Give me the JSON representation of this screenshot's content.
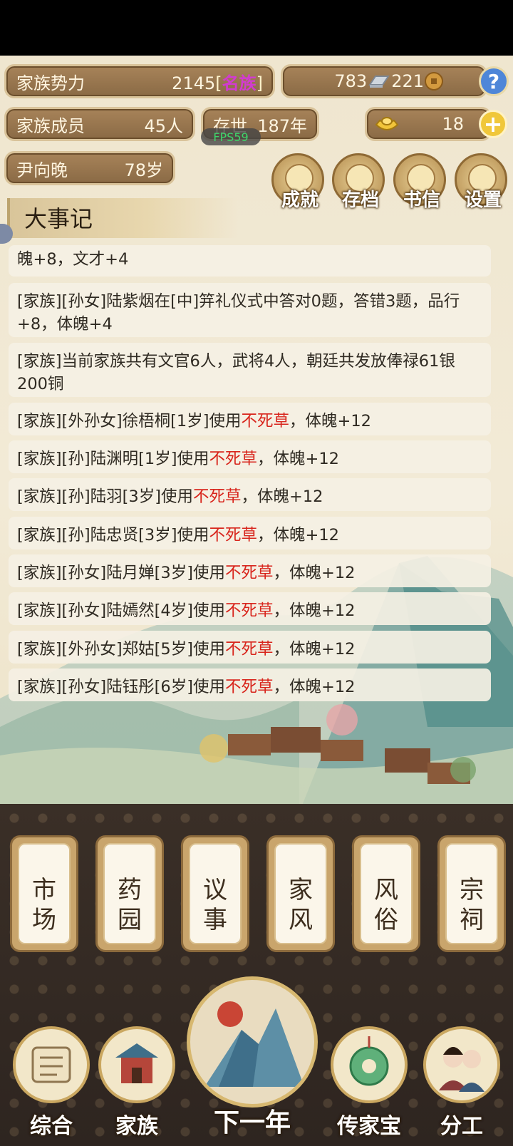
{
  "header": {
    "clan_power_label": "家族势力",
    "clan_power_value": "2145",
    "bracket_open": "[",
    "clan_rank": "名族",
    "bracket_close": "]",
    "silver": "783",
    "copper": "221",
    "help_icon_text": "?",
    "members_label": "家族成员",
    "members_value": "45人",
    "existence_label": "存世",
    "existence_value": "187年",
    "gold": "18",
    "plus_text": "+",
    "leader_name": "尹向晚",
    "leader_age": "78岁",
    "fps": "FPS59"
  },
  "menu_buttons": [
    {
      "label": "成就",
      "icon": "achievement-icon"
    },
    {
      "label": "存档",
      "icon": "save-icon"
    },
    {
      "label": "书信",
      "icon": "letter-icon"
    },
    {
      "label": "设置",
      "icon": "settings-icon"
    }
  ],
  "chronicle": {
    "title": "大事记",
    "entries": [
      {
        "pre": "魄+8，文才+4",
        "red": "",
        "post": ""
      },
      {
        "pre": "[家族][孙女]陆紫烟在[中]笄礼仪式中答对0题，答错3题，品行+8，体魄+4",
        "red": "",
        "post": ""
      },
      {
        "pre": "[家族]当前家族共有文官6人，武将4人，朝廷共发放俸禄61银200铜",
        "red": "",
        "post": ""
      },
      {
        "pre": "[家族][外孙女]徐梧桐[1岁]使用",
        "red": "不死草",
        "post": "，体魄+12"
      },
      {
        "pre": "[家族][孙]陆渊明[1岁]使用",
        "red": "不死草",
        "post": "，体魄+12"
      },
      {
        "pre": "[家族][孙]陆羽[3岁]使用",
        "red": "不死草",
        "post": "，体魄+12"
      },
      {
        "pre": "[家族][孙]陆忠贤[3岁]使用",
        "red": "不死草",
        "post": "，体魄+12"
      },
      {
        "pre": "[家族][孙女]陆月婵[3岁]使用",
        "red": "不死草",
        "post": "，体魄+12"
      },
      {
        "pre": "[家族][孙女]陆嫣然[4岁]使用",
        "red": "不死草",
        "post": "，体魄+12"
      },
      {
        "pre": "[家族][外孙女]郑姑[5岁]使用",
        "red": "不死草",
        "post": "，体魄+12"
      },
      {
        "pre": "[家族][孙女]陆钰彤[6岁]使用",
        "red": "不死草",
        "post": "，体魄+12"
      }
    ]
  },
  "cards": [
    {
      "top": "市",
      "bottom": "场"
    },
    {
      "top": "药",
      "bottom": "园"
    },
    {
      "top": "议",
      "bottom": "事"
    },
    {
      "top": "家",
      "bottom": "风"
    },
    {
      "top": "风",
      "bottom": "俗"
    },
    {
      "top": "宗",
      "bottom": "祠"
    }
  ],
  "bottom_nav": {
    "overview": "综合",
    "family": "家族",
    "next_year": "下一年",
    "heirloom": "传家宝",
    "division": "分工"
  }
}
